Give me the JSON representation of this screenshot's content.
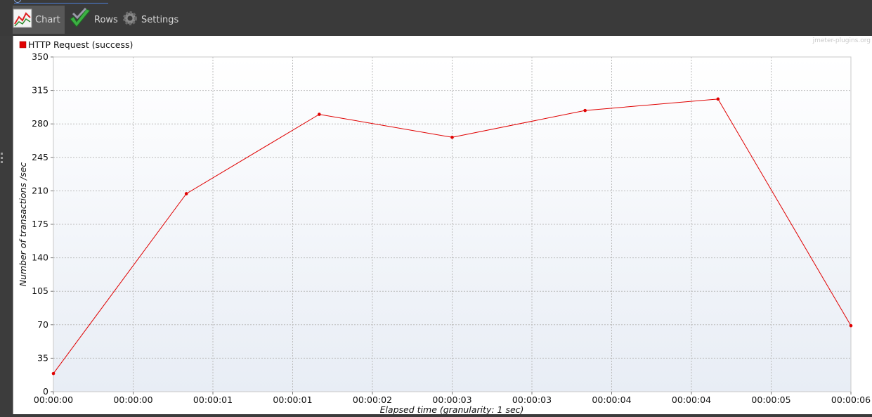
{
  "tabs": [
    {
      "label": "Chart",
      "icon": "line-chart-icon",
      "active": true
    },
    {
      "label": "Rows",
      "icon": "checkmark-icon",
      "active": false
    },
    {
      "label": "Settings",
      "icon": "gear-icon",
      "active": false
    }
  ],
  "watermark": "jmeter-plugins.org",
  "colors": {
    "series": "#e00000",
    "grid": "#bcbcbc",
    "bg_top": "#ffffff",
    "bg_bottom": "#e8edf5"
  },
  "chart_data": {
    "type": "line",
    "xlabel": "Elapsed time (granularity: 1 sec)",
    "ylabel": "Number of transactions /sec",
    "ylim": [
      0,
      350
    ],
    "yticks": [
      "0",
      "35",
      "70",
      "105",
      "140",
      "175",
      "210",
      "245",
      "280",
      "315",
      "350"
    ],
    "xticks": [
      "00:00:00",
      "00:00:00",
      "00:00:01",
      "00:00:01",
      "00:00:02",
      "00:00:03",
      "00:00:03",
      "00:00:04",
      "00:00:04",
      "00:00:05",
      "00:00:06"
    ],
    "legend_position": "top-left",
    "grid": true,
    "series": [
      {
        "name": "HTTP Request (success)",
        "x": [
          "00:00:00",
          "00:00:01",
          "00:00:02",
          "00:00:03",
          "00:00:04",
          "00:00:05",
          "00:00:06"
        ],
        "values": [
          19,
          207,
          290,
          266,
          294,
          306,
          69
        ]
      }
    ]
  }
}
